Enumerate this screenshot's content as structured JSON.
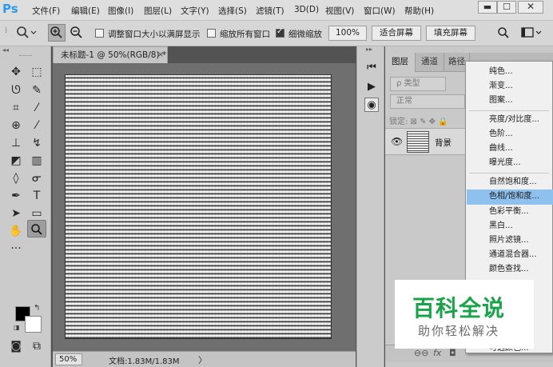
{
  "app": {
    "logo": "Ps"
  },
  "menubar": {
    "items": [
      "文件(F)",
      "编辑(E)",
      "图像(I)",
      "图层(L)",
      "文字(Y)",
      "选择(S)",
      "滤镜(T)",
      "3D(D)",
      "视图(V)",
      "窗口(W)",
      "帮助(H)"
    ],
    "window_controls": {
      "minimize": "▬",
      "maximize": "☐",
      "close": "✕"
    }
  },
  "options_bar": {
    "tool_icon": "zoom-icon",
    "resize_windows_label": "调整窗口大小以满屏显示",
    "resize_windows_checked": false,
    "zoom_all_windows_label": "缩放所有窗口",
    "zoom_all_windows_checked": false,
    "scrubby_zoom_label": "细微缩放",
    "scrubby_zoom_checked": true,
    "btn_100": "100%",
    "btn_fit": "适合屏幕",
    "btn_fill": "填充屏幕"
  },
  "document": {
    "tab_title": "未标题-1 @ 50%(RGB/8) *",
    "tab_close": "×",
    "zoom": "50%",
    "info": "文档:1.83M/1.83M",
    "info_arrow": "〉"
  },
  "layers_panel": {
    "tabs": [
      "图层",
      "通道",
      "路径"
    ],
    "kind_filter": "ρ 类型",
    "blend_mode": "正常",
    "lock_label": "锁定: ⊠ ✎ ✥ 🔒",
    "layer": {
      "name": "背景"
    }
  },
  "adjustment_menu": {
    "items": [
      "纯色...",
      "渐变...",
      "图案...",
      "亮度/对比度...",
      "色阶...",
      "曲线...",
      "曝光度...",
      "自然饱和度...",
      "色相/饱和度...",
      "色彩平衡...",
      "黑白...",
      "照片滤镜...",
      "通道混合器...",
      "颜色查找...",
      "可选颜色..."
    ],
    "highlighted": "色相/饱和度..."
  },
  "watermark": {
    "title": "百科全说",
    "subtitle": "助你轻松解决"
  },
  "colors": {
    "highlight": "#8fc1ee",
    "watermark_green": "#1aa34a",
    "ps_blue": "#2d9bf0"
  }
}
